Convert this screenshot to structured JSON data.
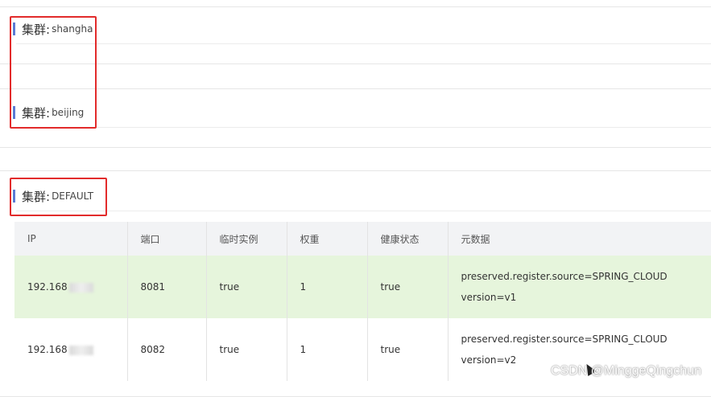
{
  "clusters": [
    {
      "label": "集群:",
      "name": "shangha"
    },
    {
      "label": "集群:",
      "name": "beijing"
    },
    {
      "label": "集群:",
      "name": "DEFAULT"
    }
  ],
  "table": {
    "headers": [
      "IP",
      "端口",
      "临时实例",
      "权重",
      "健康状态",
      "元数据"
    ],
    "rows": [
      {
        "ip": "192.168",
        "port": "8081",
        "ephemeral": "true",
        "weight": "1",
        "healthy": "true",
        "meta1": "preserved.register.source=SPRING_CLOUD",
        "meta2": "version=v1"
      },
      {
        "ip": "192.168",
        "port": "8082",
        "ephemeral": "true",
        "weight": "1",
        "healthy": "true",
        "meta1": "preserved.register.source=SPRING_CLOUD",
        "meta2": "version=v2"
      }
    ]
  },
  "watermark": "CSDN @MinggeQingchun",
  "colors": {
    "accent_bar": "#5b7bd5",
    "highlight_box": "#e22b2b",
    "row_highlight": "#e6f5dc"
  }
}
